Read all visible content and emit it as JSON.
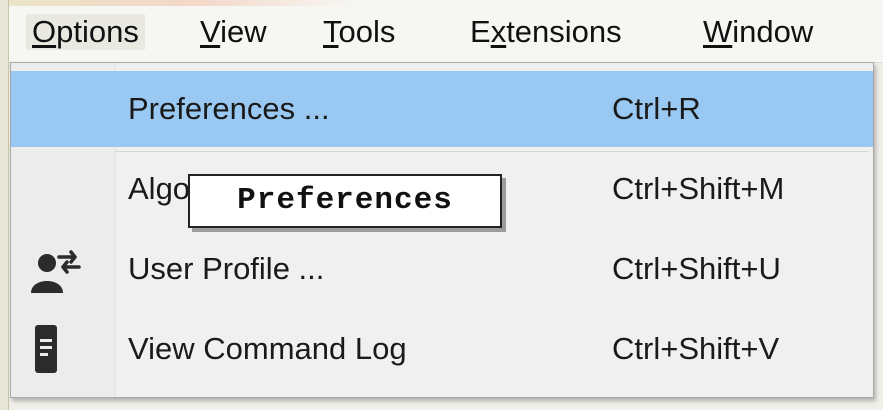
{
  "menubar": {
    "items": [
      {
        "label": "Options",
        "mnemonic": "O",
        "rest": "ptions"
      },
      {
        "label": "View",
        "mnemonic": "V",
        "rest": "iew"
      },
      {
        "label": "Tools",
        "mnemonic": "T",
        "rest": "ools"
      },
      {
        "label": "Extensions",
        "pre": "E",
        "mnemonic": "x",
        "rest": "tensions"
      },
      {
        "label": "Window",
        "mnemonic": "W",
        "rest": "indow"
      }
    ]
  },
  "menu": {
    "items": [
      {
        "label": "Preferences ...",
        "shortcut": "Ctrl+R",
        "icon": "none",
        "highlighted": true
      },
      {
        "label": "Algo",
        "shortcut": "Ctrl+Shift+M",
        "icon": "none"
      },
      {
        "label": "User Profile ...",
        "shortcut": "Ctrl+Shift+U",
        "icon": "user-profile-icon"
      },
      {
        "label": "View Command Log",
        "shortcut": "Ctrl+Shift+V",
        "icon": "document-icon"
      }
    ]
  },
  "tooltip": {
    "text": "Preferences"
  },
  "colors": {
    "highlight": "#99c9f2",
    "menu_bg": "#f0f0f0",
    "icon_dark": "#2b2b2b"
  }
}
